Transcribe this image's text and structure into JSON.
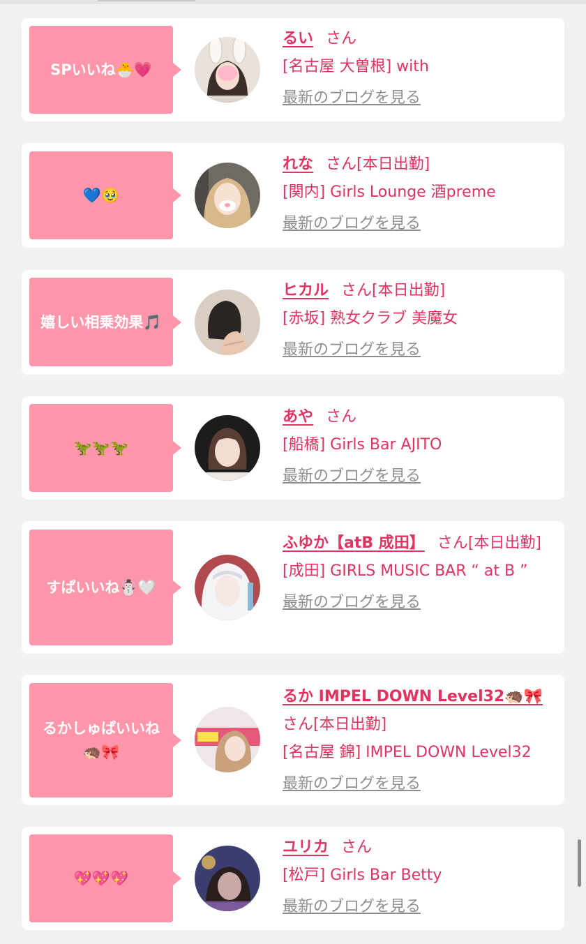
{
  "blog_link_label": "最新のブログを見る",
  "honorific": "さん",
  "colors": {
    "bubble": "#ff96a9",
    "accent_text": "#e0335f",
    "link_gray": "#8e8e8e",
    "card": "#ffffff",
    "background": "#f1f1f1"
  },
  "entries": [
    {
      "comment": "SPいいね🐣💗",
      "name": "るい",
      "status": "",
      "shop": "[名古屋 大曽根] with",
      "avatar_icon": "profile-photo"
    },
    {
      "comment": "💙🥹",
      "name": "れな",
      "status": "[本日出勤]",
      "shop": "[関内] Girls Lounge 酒preme",
      "avatar_icon": "profile-photo"
    },
    {
      "comment": "嬉しい相乗効果🎵",
      "name": "ヒカル",
      "status": "[本日出勤]",
      "shop": "[赤坂] 熟女クラブ 美魔女",
      "avatar_icon": "profile-photo"
    },
    {
      "comment": "🦖🦖🦖",
      "name": "あや",
      "status": "",
      "shop": "[船橋] Girls Bar AJITO",
      "avatar_icon": "profile-photo"
    },
    {
      "comment": "すぱいいね☃️🤍",
      "name": "ふゆか【atB 成田】",
      "status": "[本日出勤]",
      "shop": "[成田] GIRLS MUSIC BAR “ at B ”",
      "avatar_icon": "profile-photo"
    },
    {
      "comment": "るかしゅぱいいね🦔🎀",
      "name": "るか IMPEL DOWN Level32🦔🎀",
      "status": "[本日出勤]",
      "shop": "[名古屋 錦] IMPEL DOWN Level32",
      "avatar_icon": "profile-photo"
    },
    {
      "comment": "💖💖💖",
      "name": "ユリカ",
      "status": "",
      "shop": "[松戸] Girls Bar Betty",
      "avatar_icon": "profile-photo"
    }
  ]
}
